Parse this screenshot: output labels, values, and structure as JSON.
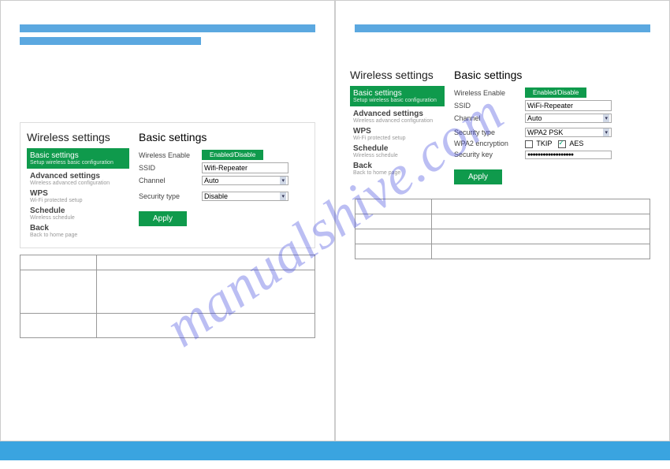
{
  "watermark": "manualshive.com",
  "left": {
    "sidebar_title": "Wireless settings",
    "nav": [
      {
        "label": "Basic settings",
        "desc": "Setup wireless basic configuration"
      },
      {
        "label": "Advanced settings",
        "desc": "Wireless advanced configuration"
      },
      {
        "label": "WPS",
        "desc": "Wi-Fi protected setup"
      },
      {
        "label": "Schedule",
        "desc": "Wireless schedule"
      },
      {
        "label": "Back",
        "desc": "Back to home page"
      }
    ],
    "content_title": "Basic settings",
    "rows": {
      "wireless_enable": "Wireless Enable",
      "enable_btn": "Enabled/Disable",
      "ssid": "SSID",
      "ssid_value": "Wifi-Repeater",
      "channel": "Channel",
      "channel_value": "Auto",
      "security_type": "Security type",
      "security_value": "Disable",
      "apply": "Apply"
    }
  },
  "right": {
    "sidebar_title": "Wireless settings",
    "nav": [
      {
        "label": "Basic settings",
        "desc": "Setup wireless basic configuration"
      },
      {
        "label": "Advanced settings",
        "desc": "Wireless advanced configuration"
      },
      {
        "label": "WPS",
        "desc": "Wi-Fi protected setup"
      },
      {
        "label": "Schedule",
        "desc": "Wireless schedule"
      },
      {
        "label": "Back",
        "desc": "Back to home page"
      }
    ],
    "content_title": "Basic settings",
    "rows": {
      "wireless_enable": "Wireless Enable",
      "enable_btn": "Enabled/Disable",
      "ssid": "SSID",
      "ssid_value": "WiFi-Repeater",
      "channel": "Channel",
      "channel_value": "Auto",
      "security_type": "Security type",
      "security_value": "WPA2 PSK",
      "wpa2_enc": "WPA2  encryption",
      "tkip": "TKIP",
      "aes": "AES",
      "security_key": "Security key",
      "key_value": "●●●●●●●●●●●●●●●●●●",
      "apply": "Apply"
    }
  }
}
